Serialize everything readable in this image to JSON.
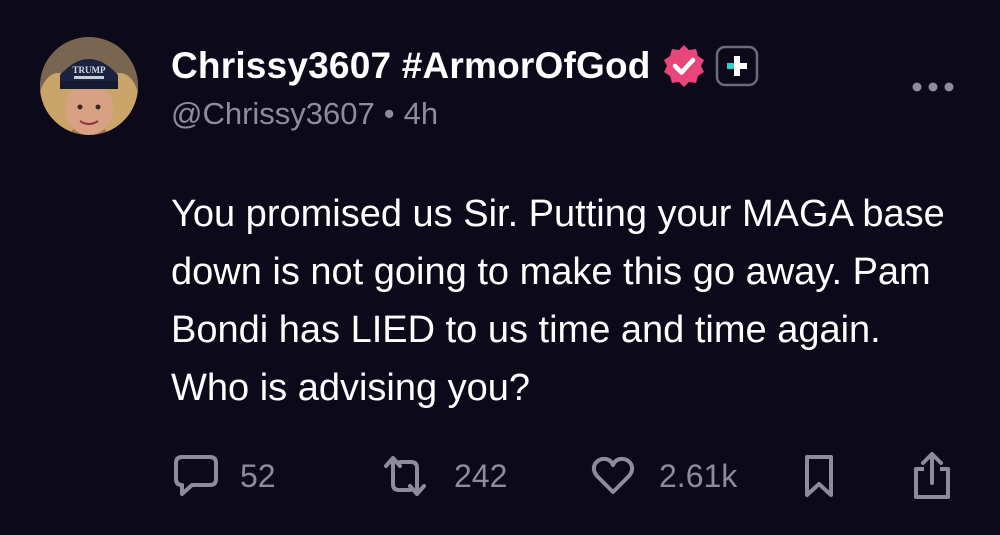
{
  "post": {
    "display_name": "Chrissy3607 #ArmorOfGod",
    "handle": "@Chrissy3607",
    "separator": "•",
    "time": "4h",
    "text": "You promised us Sir. Putting your MAGA base down is not going to make this go away. Pam Bondi has LIED to us time and time again. Who is advising you?",
    "avatar_hat_text": "TRUMP"
  },
  "actions": {
    "replies": "52",
    "reposts": "242",
    "likes": "2.61k"
  },
  "icons": {
    "avatar": "profile-photo",
    "verified": "verified-badge-icon",
    "subscribe": "plus-badge-icon",
    "more": "more-dots-icon",
    "reply": "comment-icon",
    "repost": "repost-icon",
    "like": "heart-icon",
    "bookmark": "bookmark-icon",
    "share": "share-icon"
  },
  "colors": {
    "background": "#0c0a1a",
    "text": "#ffffff",
    "muted": "#8e8b9c",
    "verified": "#e8457a",
    "subscribe_accent": "#29d3c6"
  }
}
